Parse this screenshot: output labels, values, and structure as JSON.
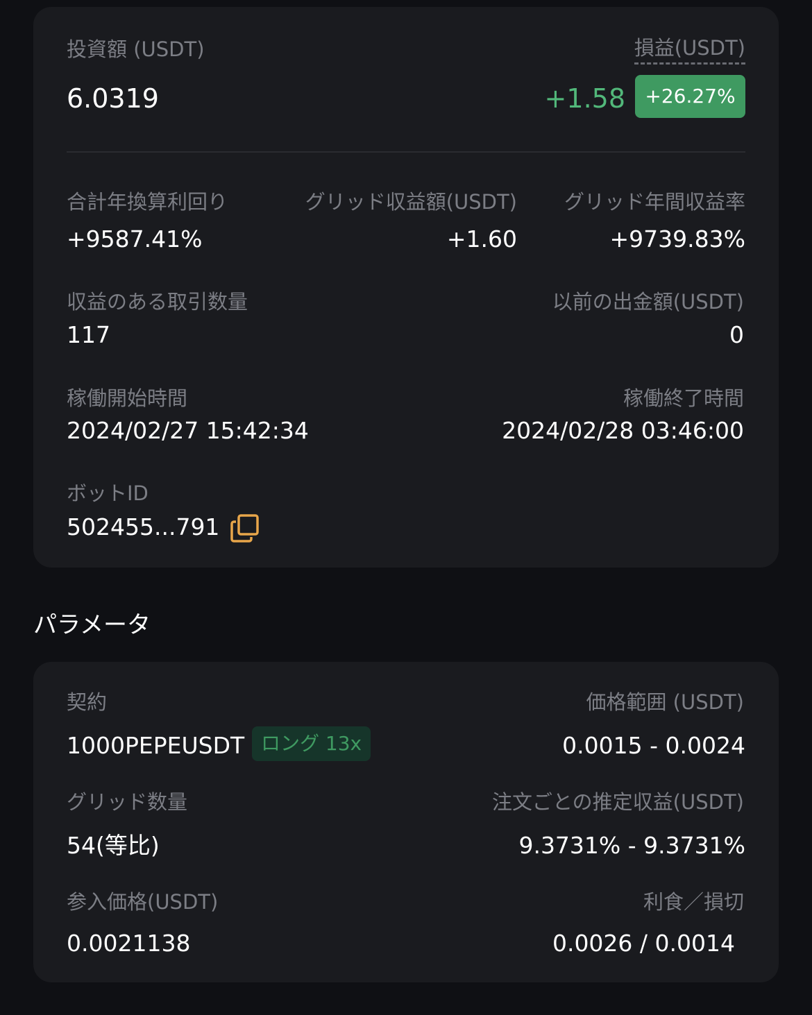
{
  "summary": {
    "investment_label": "投資額 (USDT)",
    "investment_value": "6.0319",
    "pnl_label": "損益(USDT)",
    "pnl_value": "+1.58",
    "pnl_percent": "+26.27%",
    "total_annual_yield_label": "合計年換算利回り",
    "total_annual_yield_value": "+9587.41%",
    "grid_profit_label": "グリッド収益額(USDT)",
    "grid_profit_value": "+1.60",
    "grid_annual_rate_label": "グリッド年間収益率",
    "grid_annual_rate_value": "+9739.83%",
    "profitable_trades_label": "収益のある取引数量",
    "profitable_trades_value": "117",
    "previous_withdrawal_label": "以前の出金額(USDT)",
    "previous_withdrawal_value": "0",
    "start_time_label": "稼働開始時間",
    "start_time_value": "2024/02/27 15:42:34",
    "end_time_label": "稼働終了時間",
    "end_time_value": "2024/02/28 03:46:00",
    "bot_id_label": "ボットID",
    "bot_id_value": "502455...791",
    "copy_icon": "copy-icon"
  },
  "parameters": {
    "section_title": "パラメータ",
    "contract_label": "契約",
    "contract_value": "1000PEPEUSDT",
    "position_tag": "ロング 13x",
    "price_range_label": "価格範囲 (USDT)",
    "price_range_value": "0.0015 - 0.0024",
    "grid_count_label": "グリッド数量",
    "grid_count_value": "54(等比)",
    "est_profit_label": "注文ごとの推定収益(USDT)",
    "est_profit_value": "9.3731% - 9.3731%",
    "entry_price_label": "参入価格(USDT)",
    "entry_price_value": "0.0021138",
    "tp_sl_label": "利食／損切",
    "tp_sl_value": "0.0026 / 0.0014"
  },
  "colors": {
    "background": "#0f1014",
    "card": "#1a1b1f",
    "positive": "#52b87a",
    "badge": "#3f9a61",
    "copy_icon": "#e8a64a",
    "label": "#7c7e85"
  }
}
